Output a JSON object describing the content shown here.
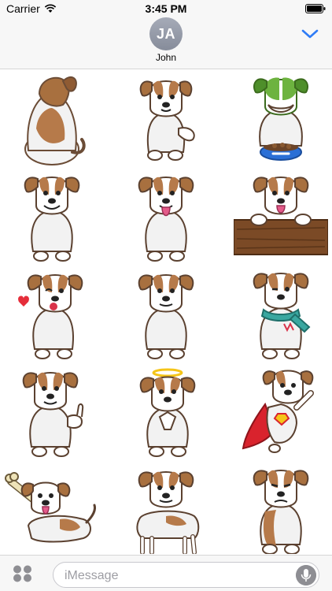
{
  "status_bar": {
    "carrier": "Carrier",
    "time": "3:45 PM",
    "icons": [
      "wifi-icon",
      "battery-icon"
    ]
  },
  "header": {
    "avatar_initials": "JA",
    "contact_name": "John",
    "collapse_icon": "chevron-down-icon",
    "accent_color": "#2f7cf6"
  },
  "stickers": [
    "dog-back-view",
    "dog-raising-paw",
    "dog-green-head-food-bowl",
    "dog-smiling",
    "dog-tongue-out",
    "dog-on-wooden-fence",
    "dog-heart-kiss",
    "dog-happy-sitting",
    "dog-scarf-winking",
    "dog-thumbs-up",
    "dog-angel-halo",
    "dog-superhero-cape",
    "dog-lying-with-bone",
    "dog-standing",
    "dog-grumpy"
  ],
  "input_bar": {
    "apps_icon": "app-drawer-icon",
    "placeholder": "iMessage",
    "mic_icon": "microphone-icon"
  }
}
